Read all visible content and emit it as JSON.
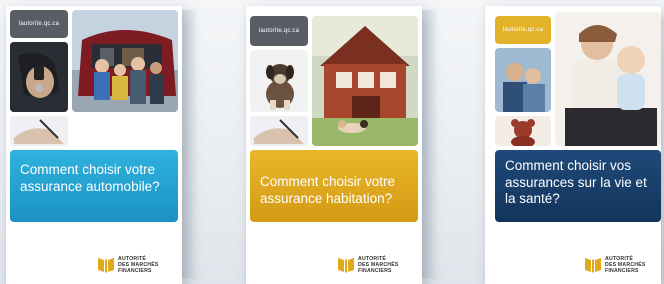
{
  "brochures": [
    {
      "url": "lautorite.qc.ca",
      "title": "Comment choisir votre assurance automobile?",
      "logo_text": "AUTORITÉ\nDES MARCHÉS\nFINANCIERS",
      "colors": {
        "band": "#1f9fd0",
        "url_tile": "#595d66"
      }
    },
    {
      "url": "lautorite.qc.ca",
      "title": "Comment choisir votre assurance habitation?",
      "logo_text": "AUTORITÉ\nDES MARCHÉS\nFINANCIERS",
      "colors": {
        "band": "#dea71c",
        "url_tile": "#595d66"
      }
    },
    {
      "url": "lautorite.qc.ca",
      "title": "Comment choisir vos assurances sur la vie et la santé?",
      "logo_text": "AUTORITÉ\nDES MARCHÉS\nFINANCIERS",
      "colors": {
        "band": "#1a3f6b",
        "url_tile": "#e2b22a"
      }
    }
  ],
  "icons": {
    "logo": "amf-flag-icon",
    "photos": [
      "car-family-photo",
      "keys-photo",
      "signing-photo",
      "house-photo",
      "dog-photo",
      "baby-family-photo",
      "couple-photo",
      "teddy-bear-photo"
    ]
  },
  "brand_gold": "#e0a91b"
}
